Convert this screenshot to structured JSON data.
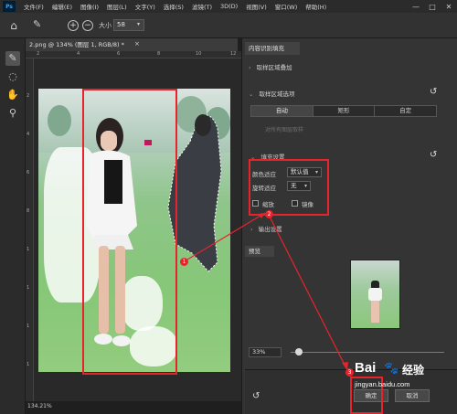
{
  "menubar": {
    "logo": "Ps",
    "items": [
      "文件(F)",
      "编辑(E)",
      "图像(I)",
      "图层(L)",
      "文字(Y)",
      "选择(S)",
      "滤镜(T)",
      "3D(D)",
      "视图(V)",
      "窗口(W)",
      "帮助(H)"
    ],
    "window_controls": [
      "—",
      "□",
      "✕"
    ]
  },
  "options": {
    "size_label": "大小",
    "size_value": "58",
    "plus": "+",
    "minus": "−"
  },
  "document": {
    "tab_title": "2.png @ 134% (图层 1, RGB/8) *",
    "close": "×",
    "zoom_status": "134.21%",
    "ruler_top": [
      "2",
      "4",
      "6",
      "8",
      "10",
      "12"
    ],
    "ruler_left": [
      "2",
      "4",
      "6",
      "8",
      "1",
      "1",
      "1",
      "1",
      "1",
      "1",
      "1",
      "1",
      "1",
      "1",
      "1",
      "1",
      "1",
      "1"
    ]
  },
  "panel": {
    "title": "内容识别填充",
    "sampling_overlay": "取样区域叠加",
    "sampling_options": "取样区域选项",
    "segments": [
      "自动",
      "矩形",
      "自定"
    ],
    "disabled_option": "对所有图层取样",
    "fill_settings": "填充设置",
    "color_adapt_label": "颜色适应",
    "color_adapt_value": "默认值",
    "rotate_adapt_label": "旋转适应",
    "rotate_adapt_value": "无",
    "scale_label": "缩放",
    "mirror_label": "镜像",
    "output_settings": "输出设置",
    "preview_label": "预览",
    "zoom_value": "33%",
    "ok_label": "确定",
    "cancel_label": "取消"
  },
  "annotations": {
    "markers": [
      "1",
      "2",
      "3"
    ],
    "color": "#e8232b"
  },
  "watermark": {
    "brand": "Bai",
    "paw": "🐾",
    "product": "经验",
    "url": "jingyan.baidu.com"
  }
}
